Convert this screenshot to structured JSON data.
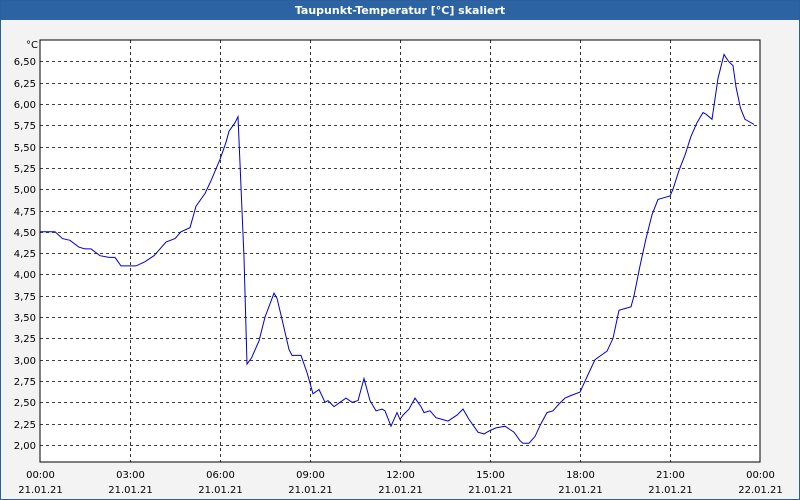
{
  "window": {
    "title": "Taupunkt-Temperatur [°C] skaliert"
  },
  "colors": {
    "titlebar": "#2c64a3",
    "line": "#0000cc",
    "grid": "#000000",
    "background": "#f3f3f3"
  },
  "chart_data": {
    "type": "line",
    "title": "Taupunkt-Temperatur [°C] skaliert",
    "ylabel": "°C",
    "xlabel": "",
    "ylim": [
      1.8,
      6.75
    ],
    "xlim": [
      0,
      24
    ],
    "grid": true,
    "y_ticks": [
      "2,00",
      "2,25",
      "2,50",
      "2,75",
      "3,00",
      "3,25",
      "3,50",
      "3,75",
      "4,00",
      "4,25",
      "4,50",
      "4,75",
      "5,00",
      "5,25",
      "5,50",
      "5,75",
      "6,00",
      "6,25",
      "6,50"
    ],
    "y_tick_values": [
      2.0,
      2.25,
      2.5,
      2.75,
      3.0,
      3.25,
      3.5,
      3.75,
      4.0,
      4.25,
      4.5,
      4.75,
      5.0,
      5.25,
      5.5,
      5.75,
      6.0,
      6.25,
      6.5
    ],
    "x_tick_values": [
      0,
      3,
      6,
      9,
      12,
      15,
      18,
      21,
      24
    ],
    "x_ticks": [
      {
        "time": "00:00",
        "date": "21.01.21"
      },
      {
        "time": "03:00",
        "date": "21.01.21"
      },
      {
        "time": "06:00",
        "date": "21.01.21"
      },
      {
        "time": "09:00",
        "date": "21.01.21"
      },
      {
        "time": "12:00",
        "date": "21.01.21"
      },
      {
        "time": "15:00",
        "date": "21.01.21"
      },
      {
        "time": "18:00",
        "date": "21.01.21"
      },
      {
        "time": "21:00",
        "date": "21.01.21"
      },
      {
        "time": "00:00",
        "date": "22.01.21"
      }
    ],
    "series": [
      {
        "x": [
          0,
          0.3,
          0.5,
          0.75,
          1.0,
          1.3,
          1.5,
          1.7,
          2.0,
          2.3,
          2.5,
          2.7,
          2.9,
          3.2,
          3.5,
          3.8,
          4.0,
          4.2,
          4.5,
          4.7,
          5.0,
          5.2,
          5.5,
          5.7,
          6.0,
          6.2,
          6.3,
          6.5,
          6.6,
          6.8,
          6.9,
          7.05,
          7.3,
          7.5,
          7.8,
          7.9,
          8.05,
          8.3,
          8.4,
          8.7,
          8.9,
          9.1,
          9.3,
          9.5,
          9.6,
          9.8,
          10.0,
          10.2,
          10.4,
          10.6,
          10.8,
          11.0,
          11.2,
          11.4,
          11.5,
          11.7,
          11.9,
          12.0,
          12.1,
          12.3,
          12.5,
          12.7,
          12.8,
          13.0,
          13.2,
          13.4,
          13.6,
          13.9,
          14.1,
          14.3,
          14.6,
          14.8,
          15.0,
          15.2,
          15.5,
          15.8,
          16.0,
          16.1,
          16.3,
          16.5,
          16.7,
          16.9,
          17.1,
          17.3,
          17.5,
          17.7,
          18.0,
          18.3,
          18.5,
          18.7,
          18.9,
          19.1,
          19.3,
          19.5,
          19.7,
          19.8,
          20.0,
          20.2,
          20.4,
          20.6,
          20.8,
          21.0,
          21.1,
          21.3,
          21.5,
          21.7,
          21.9,
          22.1,
          22.2,
          22.4,
          22.6,
          22.8,
          22.95,
          23.1,
          23.2,
          23.35,
          23.5,
          23.6,
          23.8
        ],
        "y": [
          4.5,
          4.5,
          4.5,
          4.42,
          4.4,
          4.32,
          4.3,
          4.3,
          4.22,
          4.2,
          4.2,
          4.1,
          4.1,
          4.1,
          4.15,
          4.22,
          4.3,
          4.38,
          4.42,
          4.5,
          4.55,
          4.8,
          4.95,
          5.1,
          5.35,
          5.55,
          5.68,
          5.78,
          5.85,
          4.2,
          2.95,
          3.02,
          3.22,
          3.5,
          3.78,
          3.72,
          3.5,
          3.12,
          3.05,
          3.05,
          2.85,
          2.6,
          2.65,
          2.5,
          2.52,
          2.45,
          2.5,
          2.55,
          2.5,
          2.52,
          2.78,
          2.52,
          2.4,
          2.42,
          2.4,
          2.22,
          2.38,
          2.3,
          2.35,
          2.42,
          2.55,
          2.45,
          2.38,
          2.4,
          2.32,
          2.3,
          2.28,
          2.35,
          2.42,
          2.3,
          2.15,
          2.13,
          2.17,
          2.2,
          2.22,
          2.15,
          2.05,
          2.02,
          2.02,
          2.1,
          2.25,
          2.38,
          2.4,
          2.48,
          2.55,
          2.58,
          2.62,
          2.85,
          3.0,
          3.05,
          3.1,
          3.25,
          3.58,
          3.6,
          3.62,
          3.75,
          4.1,
          4.42,
          4.7,
          4.88,
          4.9,
          4.92,
          5.0,
          5.22,
          5.4,
          5.62,
          5.78,
          5.9,
          5.88,
          5.82,
          6.3,
          6.58,
          6.5,
          6.45,
          6.2,
          5.95,
          5.82,
          5.8,
          5.76
        ]
      }
    ]
  }
}
